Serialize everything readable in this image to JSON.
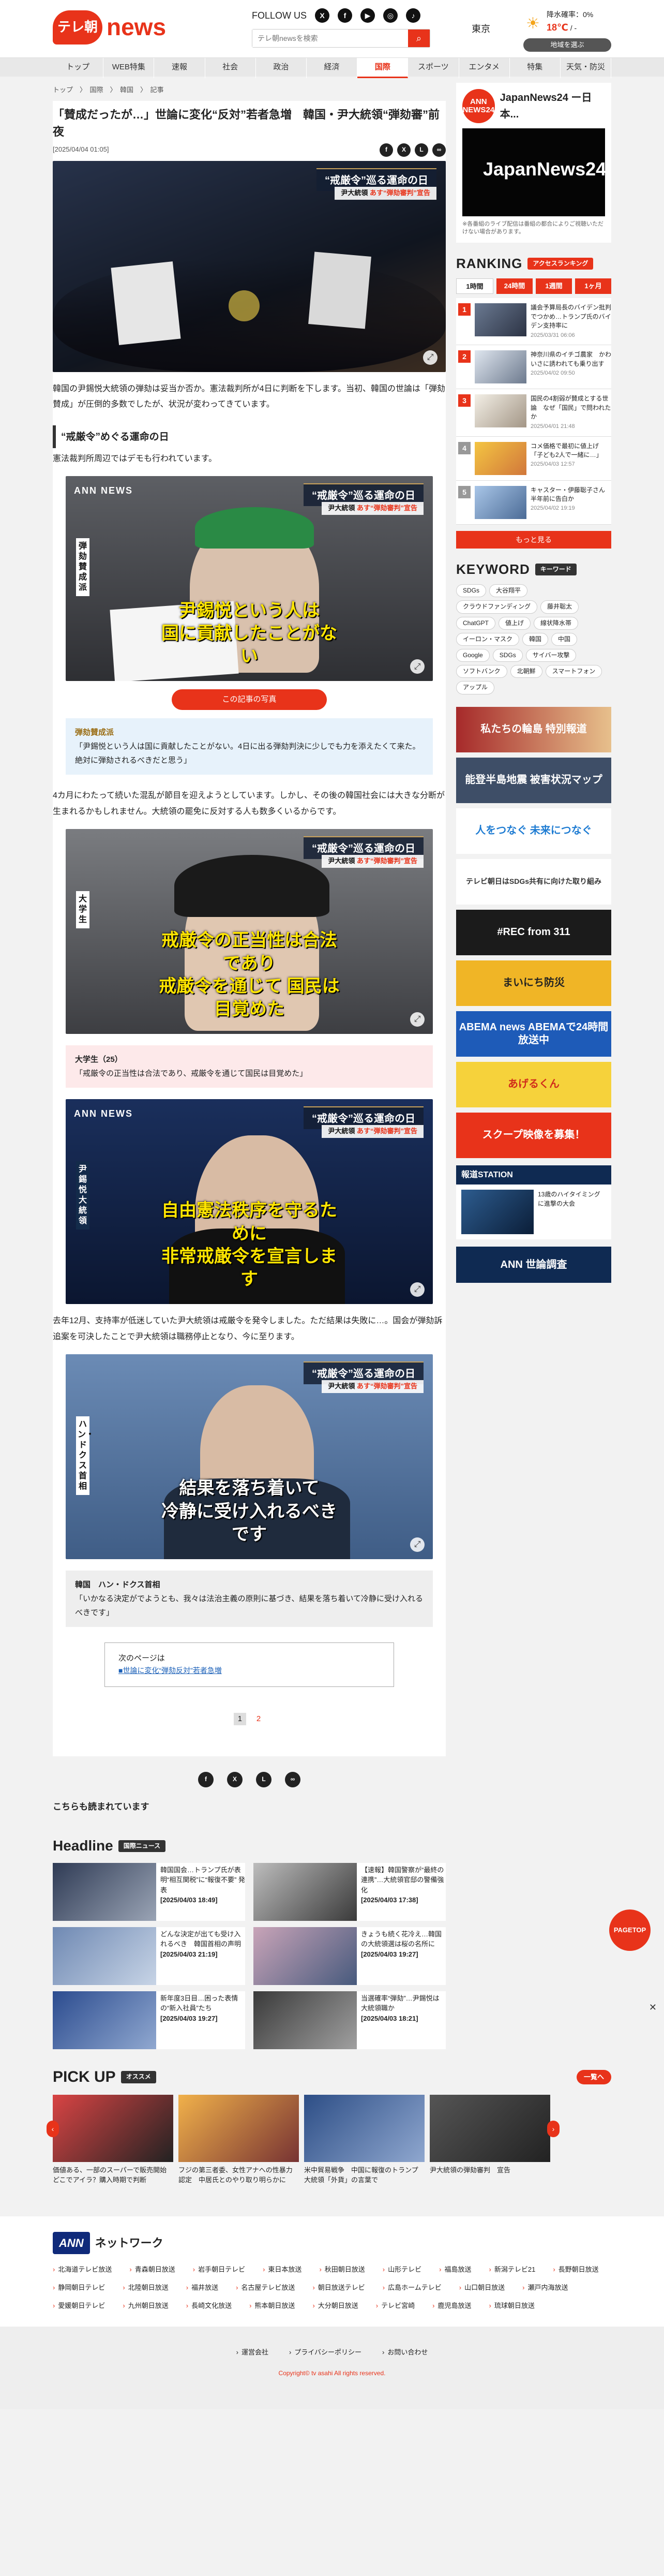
{
  "header": {
    "logo_mark": "テレ朝",
    "logo_text": "news",
    "follow_label": "FOLLOW US",
    "sns": [
      "X",
      "f",
      "▶",
      "◎",
      "♪"
    ],
    "search_placeholder": "テレ朝newsを検索",
    "weather": {
      "city": "東京",
      "precip": "降水確率：0%",
      "temp": "18℃",
      "temp_low": "/ -",
      "region_button": "地域を選ぶ"
    }
  },
  "nav": [
    "トップ",
    "WEB特集",
    "速報",
    "社会",
    "政治",
    "経済",
    "国際",
    "スポーツ",
    "エンタメ",
    "特集",
    "天気・防災"
  ],
  "nav_active": "国際",
  "breadcrumb": "トップ　〉　国際　〉　韓国　〉　記事",
  "article": {
    "title": "「賛成だったが…」世論に変化“反対”若者急増　韓国・尹大統領“弾劾審”前夜",
    "date": "[2025/04/04 01:05]",
    "photo_title": "“戒厳令”巡る運命の日",
    "photo_sub_a": "尹大統領",
    "photo_sub_b": "あす“弾劾審判”宣告",
    "p1": "韓国の尹錫悦大統領の弾劾は妥当か否か。憲法裁判所が4日に判断を下します。当初、韓国の世論は「弾劾賛成」が圧倒的多数でしたが、状況が変わってきています。",
    "h2": "“戒厳令”めぐる運命の日",
    "p2": "憲法裁判所周辺ではデモも行われています。",
    "photo2_logo": "ANN NEWS",
    "photo2_side": "弾劾賛成派",
    "photo2_cap": "尹錫悦という人は\n国に貢献したことがない",
    "photo_button": "この記事の写真",
    "q1_name": "弾劾賛成派",
    "q1_text": "「尹錫悦という人は国に貢献したことがない。4日に出る弾劾判決に少しでも力を添えたくて来た。絶対に弾劾されるべきだと思う」",
    "p3": "4カ月にわたって続いた混乱が節目を迎えようとしています。しかし、その後の韓国社会には大きな分断が生まれるかもしれません。大統領の罷免に反対する人も数多くいるからです。",
    "photo3_side": "大学生",
    "photo3_cap": "戒厳令の正当性は合法であり\n戒厳令を通じて 国民は目覚めた",
    "q2_name": "大学生（25）",
    "q2_text": "「戒厳令の正当性は合法であり、戒厳令を通じて国民は目覚めた」",
    "photo4_side": "尹錫悦大統領",
    "photo4_cap": "自由憲法秩序を守るために\n非常戒厳令を宣言します",
    "p4": "去年12月、支持率が低迷していた尹大統領は戒厳令を発令しました。ただ結果は失敗に…。国会が弾劾訴追案を可決したことで尹大統領は職務停止となり、今に至ります。",
    "photo5_side": "ハン・ドクス首相",
    "photo5_cap": "結果を落ち着いて\n冷静に受け入れるべきです",
    "q3_name": "韓国　ハン・ドクス首相",
    "q3_text": "「いかなる決定がでようとも、我々は法治主義の原則に基づき、結果を落ち着いて冷静に受け入れるべきです」",
    "next_label": "次のページは",
    "next_link": "■世論に変化“弾劾反対”若者急増",
    "pages": [
      "1",
      "2"
    ]
  },
  "also_read": "こちらも読まれています",
  "sidebar": {
    "jn_logo": "ANN\nNEWS24",
    "jn_title": "JapanNews24 ー日本...",
    "jn_video": "JapanNews24",
    "jn_note": "※各番組のライブ配信は番組の都合によりご視聴いただけない場合があります。",
    "ranking_title": "RANKING",
    "ranking_tag": "アクセスランキング",
    "tabs": [
      "1時間",
      "24時間",
      "1週間",
      "1ヶ月"
    ],
    "ranking": [
      {
        "no": "1",
        "text": "議会予算局長のバイデン批判でつかめ…トランプ氏のバイデン支持率に",
        "date": "2025/03/31 06:06"
      },
      {
        "no": "2",
        "text": "神奈川県のイチゴ農家　かわいさに誘われても乗り出す",
        "date": "2025/04/02 09:50"
      },
      {
        "no": "3",
        "text": "国民の4割弱が賛成とする世論　なぜ「国民」で問われたか",
        "date": "2025/04/01 21:48"
      },
      {
        "no": "4",
        "text": "コメ価格で最初に値上げ　「子ども2人で一緒に…」",
        "date": "2025/04/03 12:57"
      },
      {
        "no": "5",
        "text": "キャスター・伊藤聡子さん　半年前に告白か",
        "date": "2025/04/02 19:19"
      }
    ],
    "more": "もっと見る",
    "keyword_title": "KEYWORD",
    "keyword_tag": "キーワード",
    "keywords": [
      "SDGs",
      "大谷翔平",
      "クラウドファンディング",
      "藤井聡太",
      "ChatGPT",
      "値上げ",
      "線状降水帯",
      "イーロン・マスク",
      "韓国",
      "中国",
      "Google",
      "SDGs",
      "サイバー攻撃",
      "ソフトバンク",
      "北朝鮮",
      "スマートフォン",
      "アップル"
    ],
    "banners": [
      "私たちの輪島 特別報道",
      "能登半島地震 被害状況マップ",
      "人をつなぐ 未来につなぐ",
      "テレビ朝日はSDGs共有に向けた取り組み",
      "#REC from 311",
      "まいにち防災",
      "ABEMA news ABEMAで24時間放送中",
      "あげるくん",
      "スクープ映像を募集！",
      "報道STATION"
    ],
    "station_text": "13歳のハイタイミングに進撃の大会",
    "channel": "ANN 世論調査"
  },
  "headline": {
    "title": "Headline",
    "tag": "国際ニュース",
    "items": [
      {
        "text": "韓国国会…トランプ氏が表明“相互関税”に“報復不要” 発表",
        "date": "[2025/04/03 18:49]"
      },
      {
        "text": "【速報】韓国警察が“最終の連携”…大統領官邸の警備強化",
        "date": "[2025/04/03 17:38]"
      },
      {
        "text": "どんな決定が出ても受け入れるべき　韓国首相の声明",
        "date": "[2025/04/03 21:19]"
      },
      {
        "text": "きょうも続く花冷え…韓国の大統領選は桜の名所に",
        "date": "[2025/04/03 19:27]"
      },
      {
        "text": "新年度3日目…困った表情の“新入社員”たち",
        "date": "[2025/04/03 19:27]"
      },
      {
        "text": "当選確率“弾劾”…尹錫悦は大統領職か",
        "date": "[2025/04/03 18:21]"
      }
    ]
  },
  "pickup": {
    "title": "PICK UP",
    "tag": "オススメ",
    "more": "一覧へ",
    "items": [
      "価値ある、一部のスーパーで販売開始　どこでアイラ？購入時期で判断",
      "フジの第三者委、女性アナへの性暴力認定　中居氏とのやり取り明らかに",
      "米中貿易戦争　中国に報復のトランプ大統領「外貨」の言葉で",
      "尹大統領の弾劾審判　宣告"
    ]
  },
  "network": {
    "ann": "ANN",
    "title": "ネットワーク",
    "stations": [
      "北海道テレビ放送",
      "青森朝日放送",
      "岩手朝日テレビ",
      "東日本放送",
      "秋田朝日放送",
      "山形テレビ",
      "福島放送",
      "新潟テレビ21",
      "長野朝日放送",
      "静岡朝日テレビ",
      "北陸朝日放送",
      "福井放送",
      "名古屋テレビ放送",
      "朝日放送テレビ",
      "広島ホームテレビ",
      "山口朝日放送",
      "瀬戸内海放送",
      "愛媛朝日テレビ",
      "九州朝日放送",
      "長崎文化放送",
      "熊本朝日放送",
      "大分朝日放送",
      "テレビ宮崎",
      "鹿児島放送",
      "琉球朝日放送"
    ]
  },
  "footer": {
    "links": [
      "運営会社",
      "プライバシーポリシー",
      "お問い合わせ"
    ],
    "copyright": "Copyright© tv asahi All rights reserved."
  },
  "pagetop": "PAGETOP"
}
